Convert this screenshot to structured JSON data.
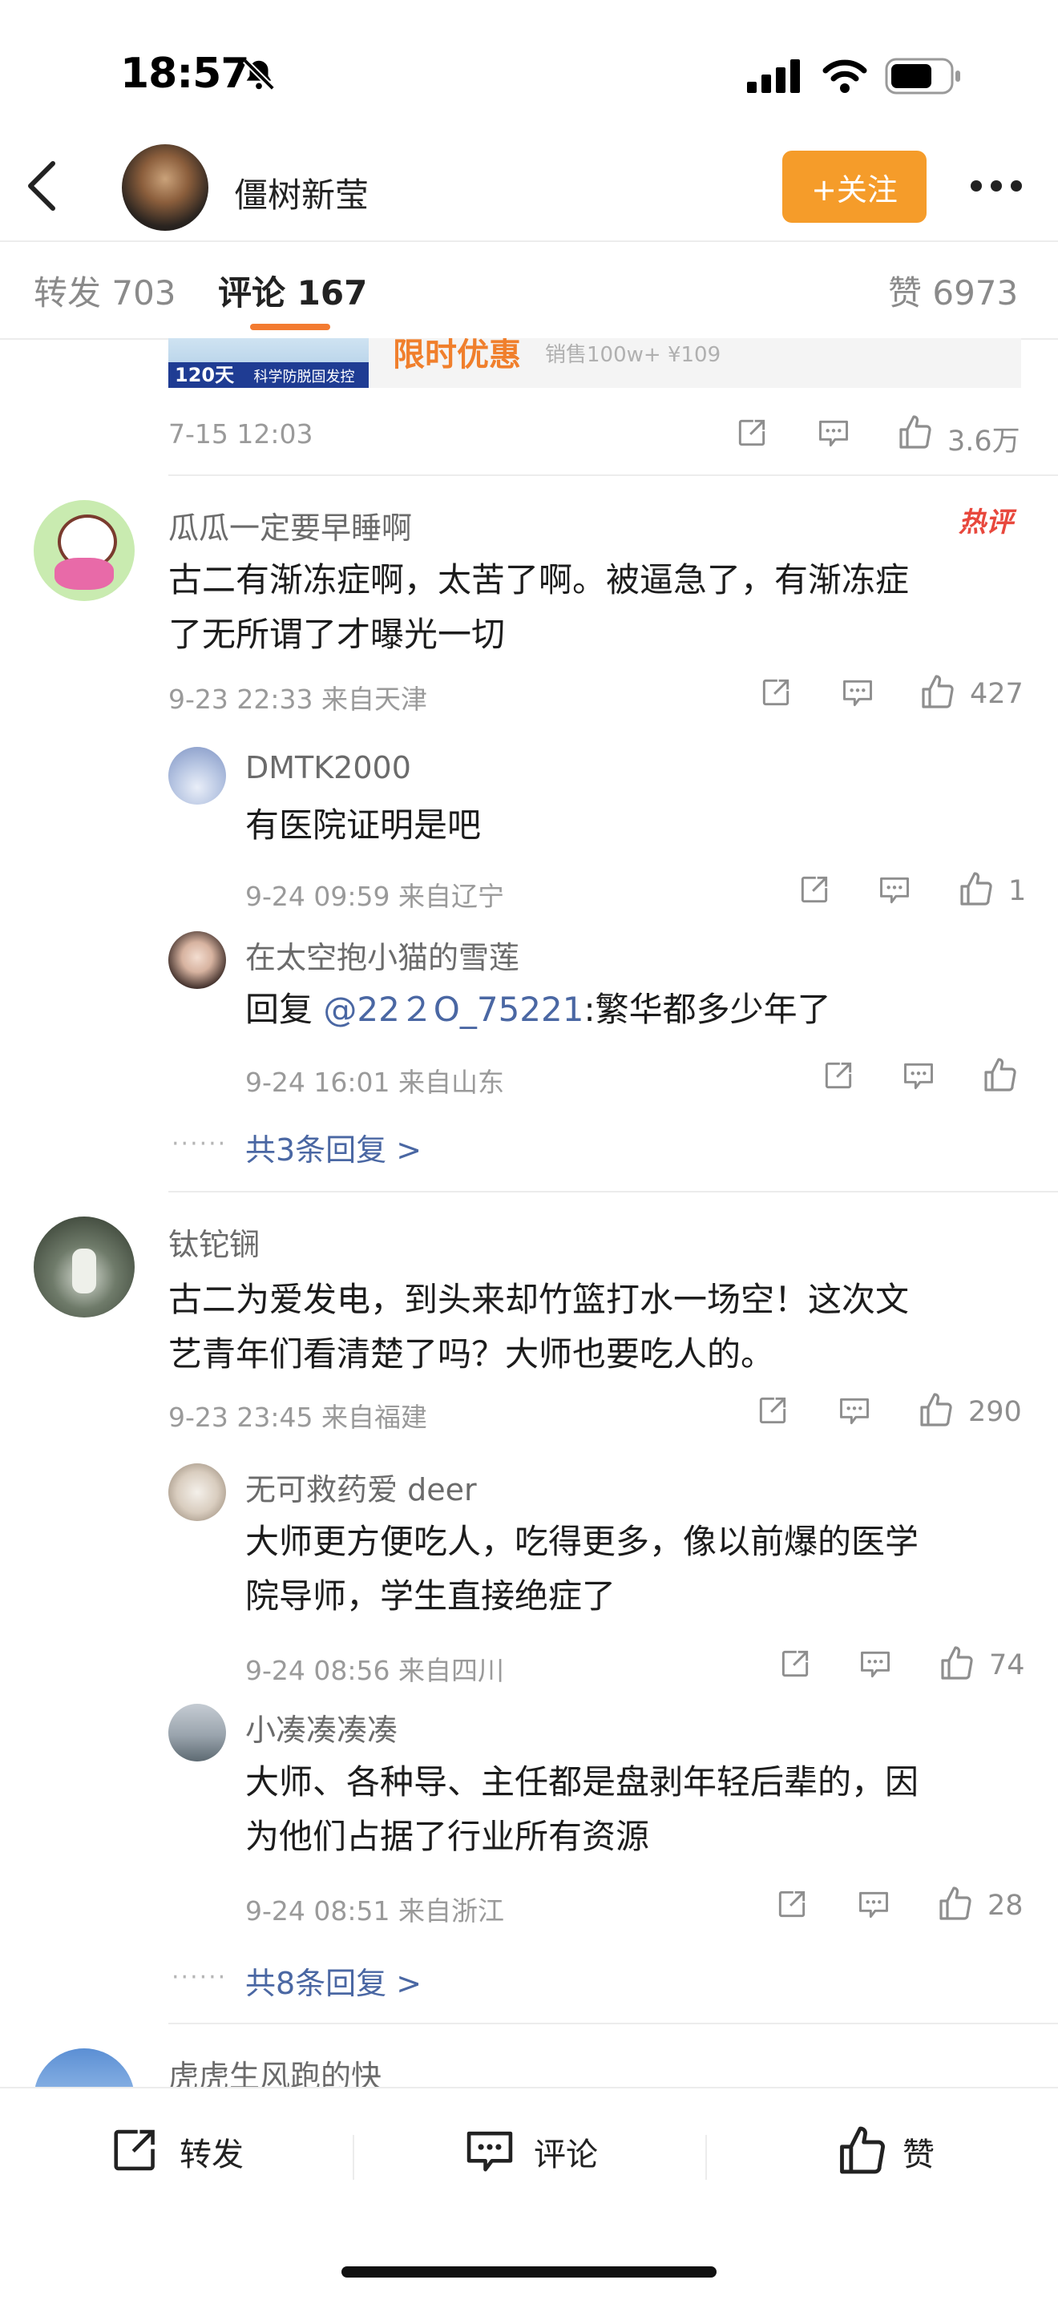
{
  "status": {
    "time": "18:57"
  },
  "header": {
    "title": "僵树新莹",
    "follow_label": "+关注"
  },
  "tabs": [
    {
      "label": "转发 703"
    },
    {
      "label": "评论 167"
    },
    {
      "label": "赞 6973"
    }
  ],
  "ad": {
    "text": "限时优惠",
    "sub": "销售100w+ ¥109",
    "badge": "120天",
    "tagline": "科学防脱固发控油"
  },
  "post_meta": {
    "date": "7-15 12:03",
    "likes": "3.6万"
  },
  "comments": [
    {
      "name": "瓜瓜一定要早睡啊",
      "hot_badge": "热评",
      "text_line1": "古二有渐冻症啊，太苦了啊。被逼急了，有渐冻症",
      "text_line2": "了无所谓了才曝光一切",
      "meta": "9-23 22:33 来自天津",
      "likes": "427",
      "replies": [
        {
          "name": "DMTK2000",
          "text": "有医院证明是吧",
          "meta": "9-24 09:59 来自辽宁",
          "likes": "1"
        },
        {
          "name": "在太空抱小猫的雪莲",
          "reply_prefix": "回复 ",
          "mention": "@22２O_75221",
          "text": ":繁华都多少年了",
          "meta": "9-24 16:01 来自山东",
          "likes": ""
        }
      ],
      "more_replies": "共3条回复 >"
    },
    {
      "name": "钛铊锎",
      "text_line1": "古二为爱发电，到头来却竹篮打水一场空！这次文",
      "text_line2": "艺青年们看清楚了吗？大师也要吃人的。",
      "meta": "9-23 23:45 来自福建",
      "likes": "290",
      "replies": [
        {
          "name": "无可救药爱 deer",
          "text_line1": "大师更方便吃人，吃得更多，像以前爆的医学",
          "text_line2": "院导师，学生直接绝症了",
          "meta": "9-24 08:56 来自四川",
          "likes": "74"
        },
        {
          "name": "小凑凑凑凑",
          "text_line1": "大师、各种导、主任都是盘剥年轻后辈的，因",
          "text_line2": "为他们占据了行业所有资源",
          "meta": "9-24 08:51 来自浙江",
          "likes": "28"
        }
      ],
      "more_replies": "共8条回复 >"
    },
    {
      "name": "虎虎生风跑的快"
    }
  ],
  "bottom_bar": {
    "repost": "转发",
    "comment": "评论",
    "like": "赞"
  },
  "colors": {
    "accent": "#f59c2a",
    "tab_underline": "#f37b30",
    "link": "#4a67a3",
    "hot": "#e8483d"
  }
}
